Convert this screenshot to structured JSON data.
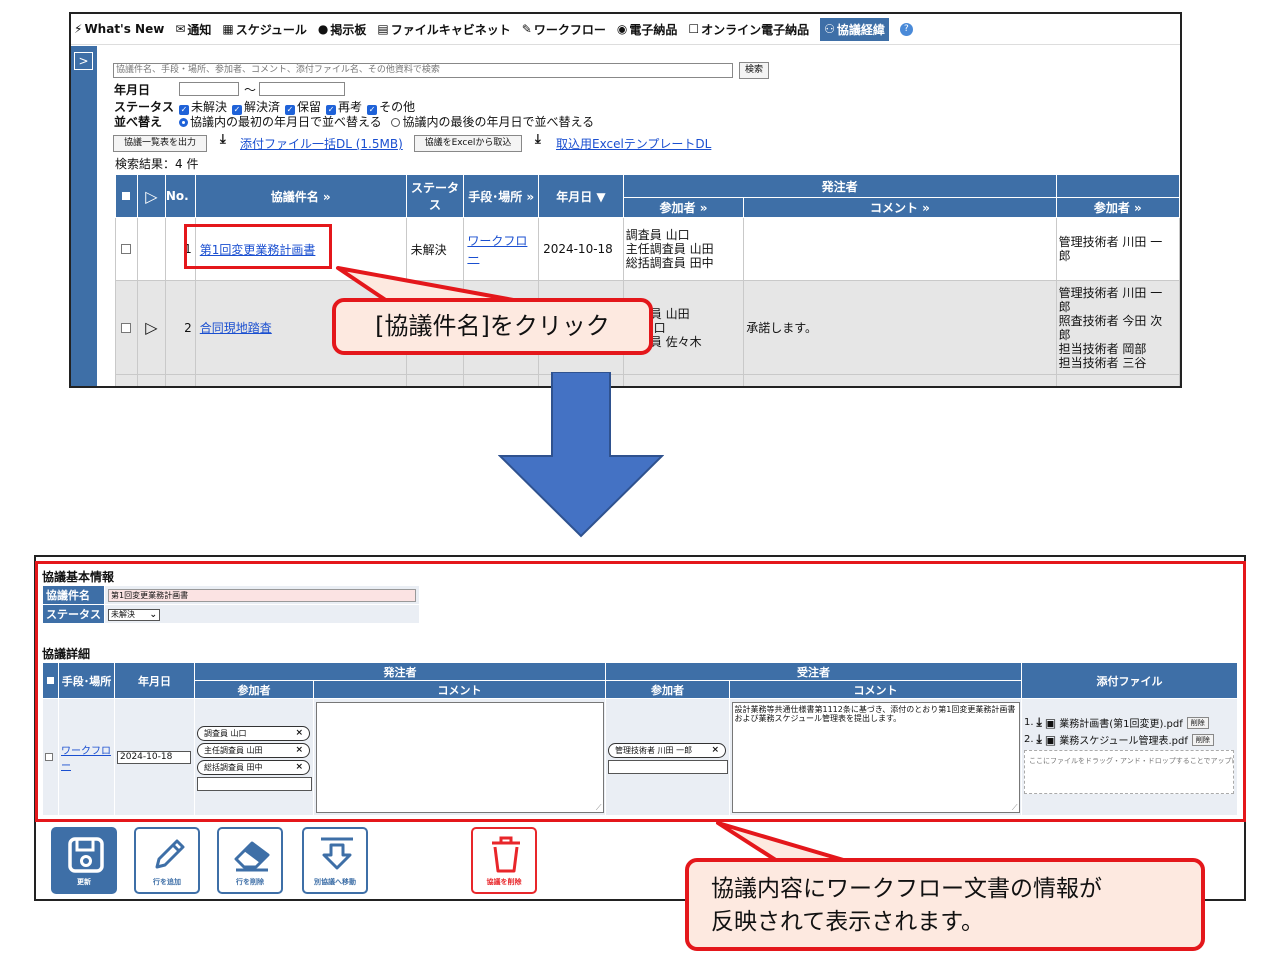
{
  "menu": {
    "items": [
      {
        "icon": "⚡",
        "label": "What's New"
      },
      {
        "icon": "✉",
        "label": "通知"
      },
      {
        "icon": "▦",
        "label": "スケジュール"
      },
      {
        "icon": "●",
        "label": "掲示板"
      },
      {
        "icon": "▤",
        "label": "ファイルキャビネット"
      },
      {
        "icon": "✎",
        "label": "ワークフロー"
      },
      {
        "icon": "◉",
        "label": "電子納品"
      },
      {
        "icon": "☐",
        "label": "オンライン電子納品"
      },
      {
        "icon": "⚇",
        "label": "協議経緯"
      }
    ],
    "help_icon": "?"
  },
  "search": {
    "placeholder": "協議件名、手段・場所、参加者、コメント、添付ファイル名、その他資料で検索",
    "button_label": "検索"
  },
  "filters": {
    "date_label": "年月日",
    "date_separator": "～",
    "status_label": "ステータス",
    "statuses": [
      "未解決",
      "解決済",
      "保留",
      "再考",
      "その他"
    ],
    "sort_label": "並べ替え",
    "sort_options": [
      "協議内の最初の年月日で並べ替える",
      "協議内の最後の年月日で並べ替える"
    ]
  },
  "actions": {
    "export_list": "協議一覧表を出力",
    "bulk_download": "添付ファイル一括DL (1.5MB)",
    "import_excel": "協議をExcelから取込",
    "template_download": "取込用ExcelテンプレートDL"
  },
  "result_count": "検索結果：4 件",
  "list": {
    "headers": {
      "no": "No.",
      "title": "協議件名 »",
      "status": "ステータス",
      "means": "手段･場所 »",
      "date": "年月日 ▼",
      "orderer": "発注者",
      "participants": "参加者 »",
      "comment": "コメント »",
      "contractor_participants": "参加者 »"
    },
    "rows": [
      {
        "no": "1",
        "title": "第1回変更業務計画書",
        "status": "未解決",
        "means": "ワークフロー",
        "date": "2024-10-18",
        "participants": [
          "調査員 山口",
          "主任調査員 山田",
          "総括調査員 田中"
        ],
        "comment": "",
        "contractor": [
          "管理技術者 川田 一",
          "郎"
        ]
      },
      {
        "no": "2",
        "title": "合同現地踏査",
        "status": "",
        "means": "",
        "date": "",
        "participants": [
          "調査員 山田",
          "員 山口",
          "課職員 佐々木"
        ],
        "comment": "承諾します。",
        "contractor": [
          "管理技術者 川田 一",
          "郎",
          "照査技術者 今田 次",
          "郎",
          "担当技術者 岡部",
          "担当技術者 三谷"
        ]
      }
    ]
  },
  "detail": {
    "basic_title": "協議基本情報",
    "title_label": "協議件名",
    "title_value": "第1回変更業務計画書",
    "status_label": "ステータス",
    "status_value": "未解決",
    "detail_title": "協議詳細",
    "headers": {
      "means": "手段･場所",
      "date": "年月日",
      "orderer": "発注者",
      "contractor": "受注者",
      "participants": "参加者",
      "comment": "コメント",
      "attachments": "添付ファイル"
    },
    "row": {
      "means": "ワークフロー",
      "date": "2024-10-18",
      "orderer_participants": [
        "調査員 山口",
        "主任調査員 山田",
        "総括調査員 田中"
      ],
      "orderer_comment": "",
      "contractor_participants": [
        "管理技術者 川田 一郎"
      ],
      "contractor_comment": "設計業務等共通仕様書第1112条に基づき、添付のとおり第1回変更業務計画書および業務スケジュール管理表を提出します。",
      "files": [
        {
          "index": "1.",
          "name": "業務計画書(第1回変更).pdf"
        },
        {
          "index": "2.",
          "name": "業務スケジュール管理表.pdf"
        }
      ],
      "delete_label": "削除",
      "drop_hint": "ここにファイルをドラッグ・アンド・ドロップすることでアップロードで"
    },
    "chip_close": "×"
  },
  "toolbar": {
    "update": "更新",
    "add_row": "行を追加",
    "delete_row": "行を削除",
    "move": "別協議へ移動",
    "delete_consult": "協議を削除"
  },
  "annotations": {
    "callout1": "[協議件名]をクリック",
    "callout2_line1": "協議内容にワークフロー文書の情報が",
    "callout2_line2": "反映されて表示されます。"
  },
  "colors": {
    "header_blue": "#3e6fa7",
    "annotation_red": "#e4171b",
    "callout_fill": "#fde9e0",
    "arrow_blue": "#4472c4"
  }
}
